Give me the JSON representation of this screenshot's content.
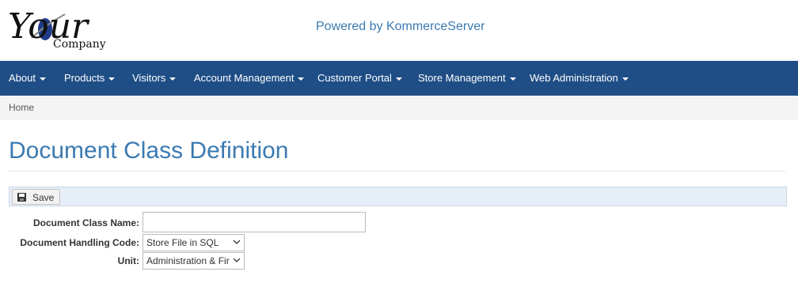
{
  "header": {
    "logo_text_top": "Your",
    "logo_text_bottom": "Company",
    "powered_by": "Powered by KommerceServer"
  },
  "nav": {
    "items": [
      {
        "label": "About"
      },
      {
        "label": "Products"
      },
      {
        "label": "Visitors"
      },
      {
        "label": "Account Management"
      },
      {
        "label": "Customer Portal"
      },
      {
        "label": "Store Management"
      },
      {
        "label": "Web Administration"
      }
    ]
  },
  "breadcrumb": {
    "home": "Home"
  },
  "page": {
    "title": "Document Class Definition"
  },
  "toolbar": {
    "save_label": "Save"
  },
  "form": {
    "name_label": "Document Class Name:",
    "name_value": "",
    "handling_label": "Document Handling Code:",
    "handling_value": "Store File in SQL",
    "unit_label": "Unit:",
    "unit_value": "Administration & Fir"
  },
  "colors": {
    "navbar": "#1f4e86",
    "title": "#3a7ab1",
    "toolbar": "#e6eef8"
  }
}
